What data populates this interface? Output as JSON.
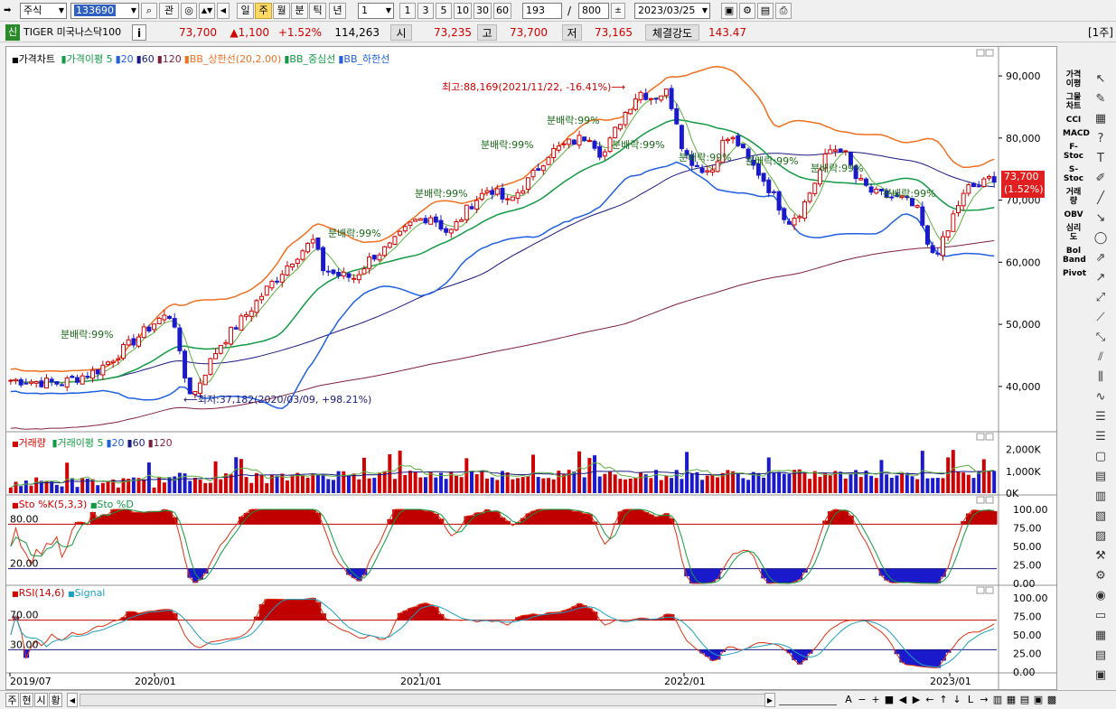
{
  "toolbar": {
    "market": "주식",
    "code": "133690",
    "btn_search": "⌕",
    "btn_watch": "관",
    "periods": [
      "일",
      "주",
      "월",
      "분",
      "틱",
      "년"
    ],
    "selected_period": "주",
    "unit_value": "1",
    "unit_buttons": [
      "1",
      "3",
      "5",
      "10",
      "30",
      "60"
    ],
    "count": "193",
    "slash": "/",
    "total": "800",
    "date": "2023/03/25"
  },
  "quote": {
    "badge": "신",
    "name": "TIGER 미국나스닥100",
    "info_btn": "i",
    "price": "73,700",
    "change": "▲1,100",
    "change_pct": "+1.52%",
    "volume": "114,263",
    "open_label": "시",
    "open": "73,235",
    "high_label": "고",
    "high": "73,700",
    "low_label": "저",
    "low": "73,165",
    "strength_label": "체결강도",
    "strength": "143.47",
    "period_tag": "[1주]"
  },
  "price_panel": {
    "title": "가격차트",
    "legend": [
      "가격이평 5",
      "20",
      "60",
      "120",
      "BB_상한선(20,2.00)",
      "BB_중심선",
      "BB_하한선"
    ],
    "yticks": [
      "90,000",
      "80,000",
      "70,000",
      "60,000",
      "50,000",
      "40,000"
    ],
    "current_label": "73,700",
    "current_pct": "(1.52%)",
    "high_note": "최고:88,169(2021/11/22, -16.41%)",
    "low_note": "최저:37,182(2020/03/09, +98.21%)",
    "dividend_note": "분배락:99%"
  },
  "volume_panel": {
    "title": "거래량",
    "legend": [
      "거래이평 5",
      "20",
      "60",
      "120"
    ],
    "yticks": [
      "2,000K",
      "1,000K",
      "0K"
    ]
  },
  "stoch_panel": {
    "title": "Sto %K(5,3,3)",
    "legend2": "Sto %D",
    "upper": "80.00",
    "lower": "20.00",
    "yticks": [
      "100.00",
      "75.00",
      "50.00",
      "25.00",
      "0.00"
    ]
  },
  "rsi_panel": {
    "title": "RSI(14,6)",
    "legend2": "Signal",
    "upper": "70.00",
    "lower": "30.00",
    "yticks": [
      "100.00",
      "75.00",
      "50.00",
      "25.00",
      "0.00"
    ]
  },
  "xaxis": [
    "2019/07",
    "2020/01",
    "2021/01",
    "2022/01",
    "2023/01"
  ],
  "indicators": [
    {
      "name": "가격이평"
    },
    {
      "name": "그물차트"
    },
    {
      "name": "CCI"
    },
    {
      "name": "MACD"
    },
    {
      "name": "F-Stoc"
    },
    {
      "name": "S-Stoc"
    },
    {
      "name": "거래량"
    },
    {
      "name": "OBV"
    },
    {
      "name": "심리도"
    },
    {
      "name": "Bol Band"
    },
    {
      "name": "Pivot"
    }
  ],
  "bottom_tabs": [
    "주",
    "현",
    "시",
    "황"
  ],
  "colors": {
    "up": "#d00000",
    "down": "#1a1acc",
    "bb_upper": "#f07020",
    "bb_mid": "#129a44",
    "bb_lower": "#2060e0",
    "ma60": "#1a1a80",
    "ma120": "#802040"
  }
}
